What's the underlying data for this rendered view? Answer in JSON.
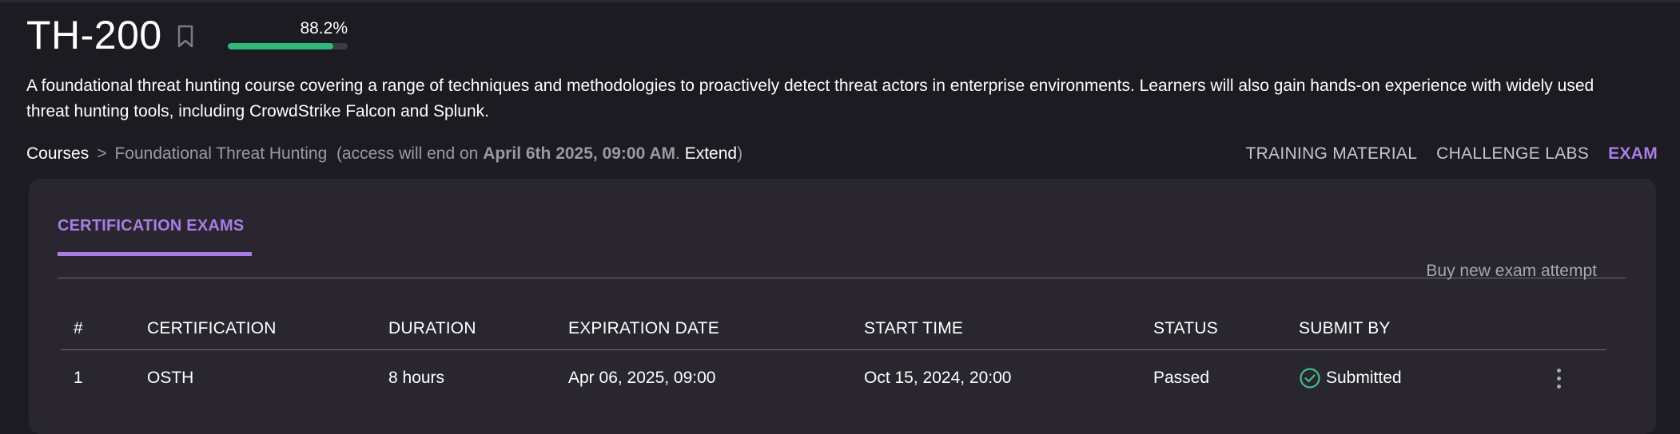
{
  "course": {
    "title": "TH-200",
    "progress_label": "88.2%",
    "progress_fraction": 0.882,
    "description": "A foundational threat hunting course covering a range of techniques and methodologies to proactively detect threat actors in enterprise environments. Learners will also gain hands-on experience with widely used threat hunting tools, including CrowdStrike Falcon and Splunk."
  },
  "breadcrumb": {
    "root": "Courses",
    "separator": ">",
    "current": "Foundational Threat Hunting",
    "access_prefix": "(access will end on ",
    "access_date": "April 6th 2025, 09:00 AM",
    "access_mid": ". ",
    "extend": "Extend",
    "access_suffix": ")"
  },
  "nav": {
    "items": [
      {
        "label": "TRAINING MATERIAL"
      },
      {
        "label": "CHALLENGE LABS"
      },
      {
        "label": "EXAM"
      }
    ],
    "active": "EXAM"
  },
  "panel": {
    "tab_label": "CERTIFICATION EXAMS",
    "buy_label": "Buy new exam attempt"
  },
  "table": {
    "headers": [
      "#",
      "CERTIFICATION",
      "DURATION",
      "EXPIRATION DATE",
      "START TIME",
      "STATUS",
      "SUBMIT BY"
    ],
    "rows": [
      {
        "num": "1",
        "certification": "OSTH",
        "duration": "8 hours",
        "expiration": "Apr 06, 2025, 09:00",
        "start": "Oct 15, 2024, 20:00",
        "status": "Passed",
        "submit_by": "Submitted"
      }
    ]
  },
  "colors": {
    "accent": "#a97de6",
    "progress": "#2fb87a",
    "success": "#3fc08a",
    "background": "#1d1b22",
    "panel": "#29262f"
  },
  "icons": {
    "bookmark": "bookmark-icon",
    "check": "check-circle-icon",
    "menu": "more-vertical-icon"
  }
}
